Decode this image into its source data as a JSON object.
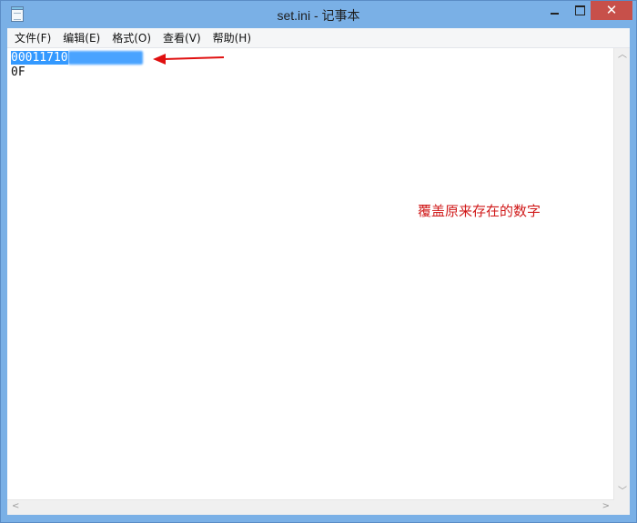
{
  "window": {
    "title": "set.ini - 记事本",
    "close_glyph": "✕"
  },
  "menu": {
    "items": [
      "文件(F)",
      "编辑(E)",
      "格式(O)",
      "查看(V)",
      "帮助(H)"
    ]
  },
  "editor": {
    "line1_selected": "00011710",
    "line2": "0F"
  },
  "annotation": {
    "text": "覆盖原来存在的数字",
    "color": "#d01a1a"
  },
  "scrollbars": {
    "up_arrow": "︿",
    "down_arrow": "﹀",
    "left_arrow": "<",
    "right_arrow": ">"
  },
  "icons": {
    "app": "notepad-icon",
    "minimize": "minimize-icon",
    "maximize": "maximize-icon",
    "close": "close-icon",
    "arrow": "red-arrow-icon"
  },
  "colors": {
    "titlebar": "#7ab0e6",
    "close_button": "#c7504a",
    "selection": "#3399ff"
  }
}
